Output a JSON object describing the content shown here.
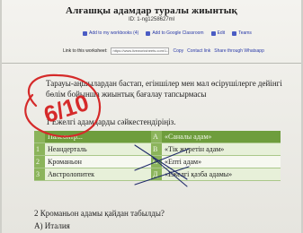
{
  "header": {
    "title": "Алғашқы адамдар туралы жиынтық",
    "worksheet_id": "ID: 1-ng1258627ml",
    "actions": [
      {
        "label": "Add to my workbooks (4)",
        "icon": "plus-icon"
      },
      {
        "label": "Add to Google Classroom",
        "icon": "classroom-icon"
      },
      {
        "label": "Edit",
        "icon": "edit-icon"
      },
      {
        "label": "Teams",
        "icon": "teams-icon"
      }
    ],
    "link_row": {
      "label": "Link to this worksheet:",
      "url": "https://www.liveworksheets.com/1-ng1258627ml",
      "copy": "Copy",
      "contact": "Contact link",
      "whatsapp": "Share through Whatsapp"
    }
  },
  "content": {
    "instruction": "Тарауы-аңшылардан бастап, егіншілер мен мал өсірушілерге дейінгі бөлім бойынша жиынтық бағалау тапсырмасы",
    "q1": "1 Ежелгі адамдарды сәйкестендіріңіз.",
    "table": {
      "header": {
        "num": "",
        "left": "Палеонтр...",
        "mid": "А",
        "right": "«Саналы адам»"
      },
      "rows": [
        {
          "num": "1",
          "left": "Неандерталь",
          "mid": "В",
          "right": "«Тік жүретін адам»"
        },
        {
          "num": "2",
          "left": "Кроманьон",
          "mid": "С",
          "right": "«Епті адам»"
        },
        {
          "num": "3",
          "left": "Австролопитек",
          "mid": "Д",
          "right": "«Ежелгі қазба адамы»"
        }
      ]
    },
    "q2": "2 Кроманьон адамы қайдан табылды?",
    "q2_answer": "А) Италия"
  },
  "grade": {
    "text": "6/10",
    "color": "#d52a2a"
  },
  "colors": {
    "table_header": "#6e9d3c",
    "table_row_alt": "#e7f0d9",
    "link": "#2a3aa8",
    "grade_ink": "#d52a2a",
    "pen_ink": "#1f2a6a"
  }
}
